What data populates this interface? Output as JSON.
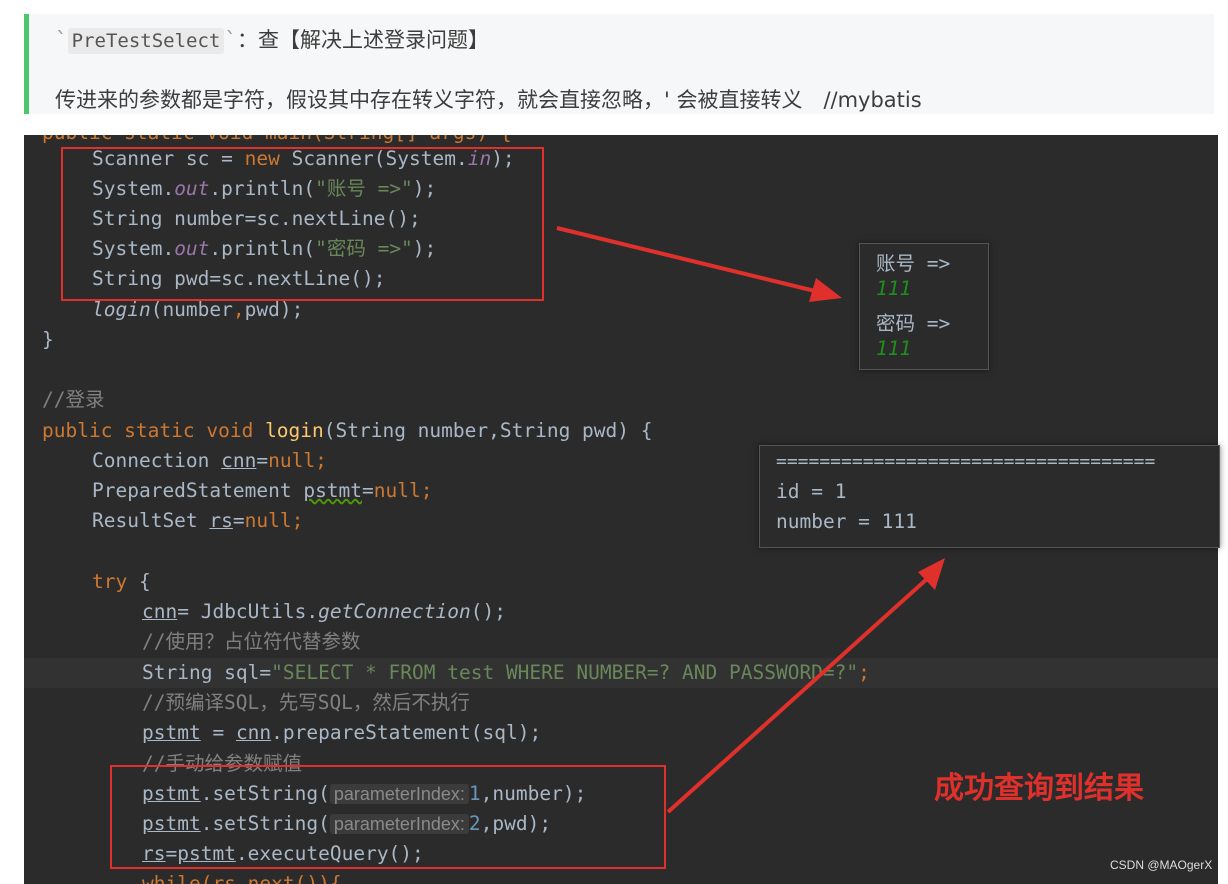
{
  "blockquote": {
    "line1_tick_open": "`",
    "line1_code": "PreTestSelect",
    "line1_tick_close": "`",
    "line1_rest": "：查【解决上述登录问题】",
    "line2": "传进来的参数都是字符，假设其中存在转义字符，就会直接忽略，' 会被直接转义　//mybatis"
  },
  "code": {
    "top_cut": "public static void main(String[] args) {",
    "l1_a": "Scanner sc = ",
    "l1_new": "new",
    "l1_b": " Scanner(System.",
    "l1_in": "in",
    "l1_c": ");",
    "l2_a": "System.",
    "l2_out": "out",
    "l2_b": ".println(",
    "l2_str": "\"账号 =>\"",
    "l2_c": ");",
    "l3": "String number=sc.nextLine();",
    "l4_a": "System.",
    "l4_out": "out",
    "l4_b": ".println(",
    "l4_str": "\"密码 =>\"",
    "l4_c": ");",
    "l5": "String pwd=sc.nextLine();",
    "l6_fn": "login",
    "l6_b": "(number",
    "l6_comma": ",",
    "l6_c": "pwd);",
    "l7": "}",
    "l8": "//登录",
    "l9_kw": "public static void ",
    "l9_fn": "login",
    "l9_b": "(String number,String pwd) {",
    "l10_a": "Connection ",
    "l10_var": "cnn",
    "l10_b": "=",
    "l10_null": "null",
    "l10_c": ";",
    "l11_a": "PreparedStatement ",
    "l11_var": "pstmt",
    "l11_b": "=",
    "l11_null": "null",
    "l11_c": ";",
    "l12_a": "ResultSet ",
    "l12_var": "rs",
    "l12_b": "=",
    "l12_null": "null",
    "l12_c": ";",
    "l13_kw": "try",
    "l13_b": " {",
    "l14_var": "cnn",
    "l14_b": "= JdbcUtils.",
    "l14_it": "getConnection",
    "l14_c": "();",
    "l15": "//使用？占位符代替参数",
    "l16_a": "String sql=",
    "l16_str": "\"SELECT * FROM test WHERE NUMBER=? AND PASSWORD=?\"",
    "l16_c": ";",
    "l17": "//预编译SQL，先写SQL，然后不执行",
    "l18_var": "pstmt",
    "l18_b": " = ",
    "l18_var2": "cnn",
    "l18_c": ".prepareStatement(sql);",
    "l19": "//手动给参数赋值",
    "l20_var": "pstmt",
    "l20_b": ".setString(",
    "l20_hint": "parameterIndex:",
    "l20_num": "1",
    "l20_c": ",number);",
    "l21_var": "pstmt",
    "l21_b": ".setString(",
    "l21_hint": "parameterIndex:",
    "l21_num": "2",
    "l21_c": ",pwd);",
    "l22_var": "rs",
    "l22_b": "=",
    "l22_var2": "pstmt",
    "l22_c": ".executeQuery();",
    "bottom_cut": "while(rs.next()){"
  },
  "console1": {
    "l1": "账号 =>",
    "l2": "111",
    "l3": "密码 =>",
    "l4": "111"
  },
  "console2": {
    "l1": "===================================",
    "l2": "id = 1",
    "l3": "number = 111"
  },
  "annotation": "成功查询到结果",
  "watermark": "CSDN @MAOgerX",
  "colors": {
    "accent_bar": "#4ac76a",
    "annotation_red": "#e0302c",
    "editor_bg": "#2b2b2b"
  }
}
